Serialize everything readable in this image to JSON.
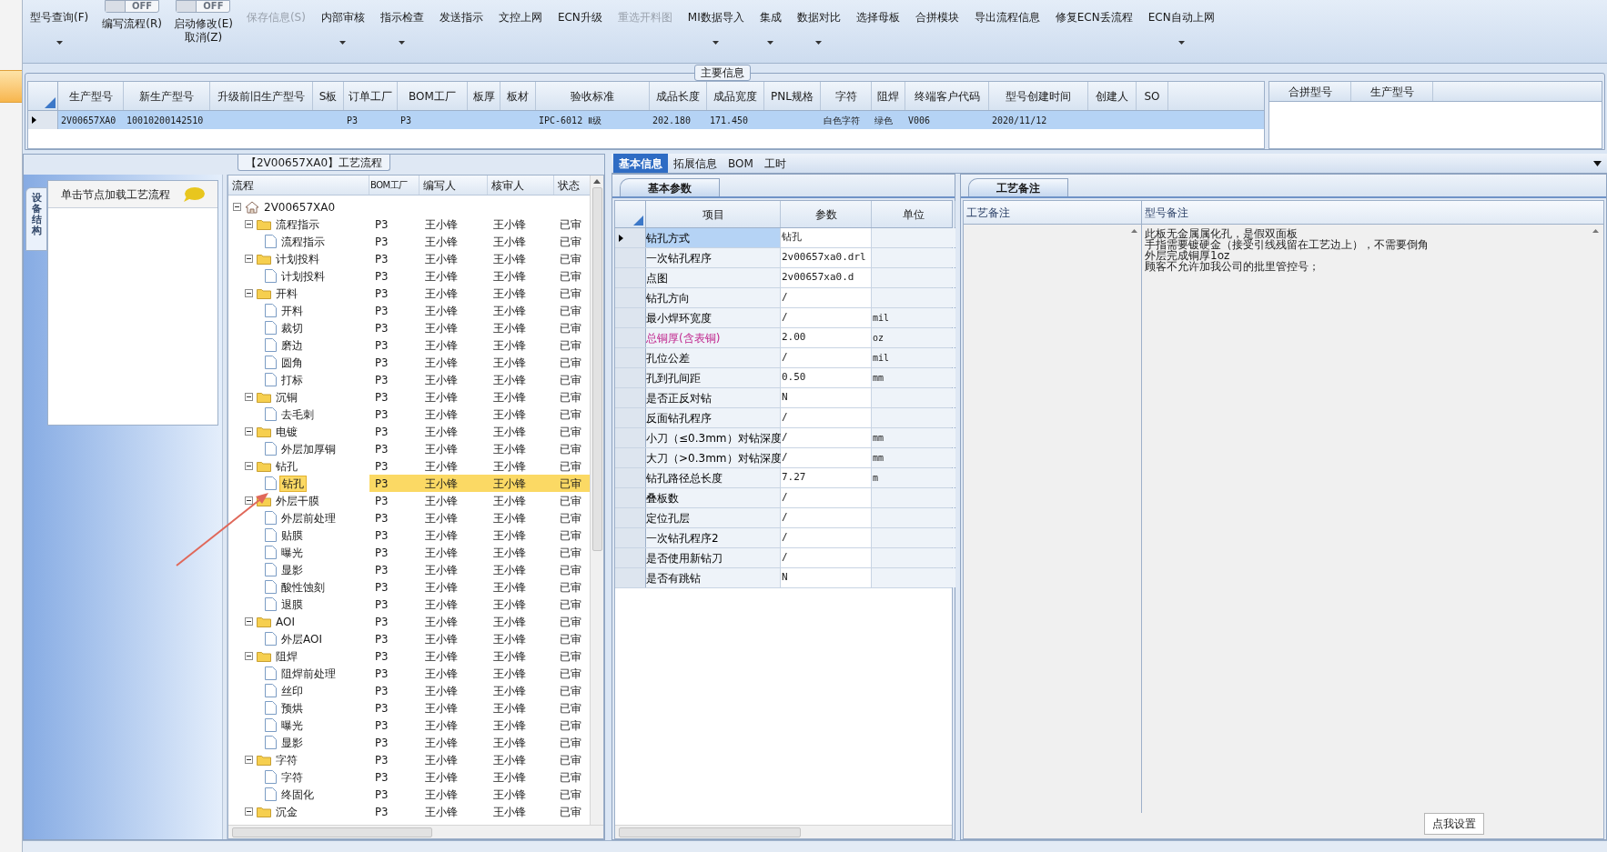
{
  "toolbar": [
    {
      "kind": "button",
      "label": "型号查询(F)",
      "dropdown": true,
      "disabled": false
    },
    {
      "kind": "toggle",
      "switch_text": "OFF",
      "on": false,
      "lines": [
        "编写流程(R)"
      ]
    },
    {
      "kind": "toggle",
      "switch_text": "OFF",
      "on": false,
      "lines": [
        "启动修改(E)",
        "取消(Z)"
      ]
    },
    {
      "kind": "button",
      "label": "保存信息(S)",
      "dropdown": false,
      "disabled": true
    },
    {
      "kind": "button",
      "label": "内部审核",
      "dropdown": true,
      "disabled": false
    },
    {
      "kind": "button",
      "label": "指示检查",
      "dropdown": true,
      "disabled": false
    },
    {
      "kind": "button",
      "label": "发送指示",
      "dropdown": false,
      "disabled": false
    },
    {
      "kind": "button",
      "label": "文控上网",
      "dropdown": false,
      "disabled": false
    },
    {
      "kind": "button",
      "label": "ECN升级",
      "dropdown": false,
      "disabled": false
    },
    {
      "kind": "button",
      "label": "重选开料图",
      "dropdown": false,
      "disabled": true
    },
    {
      "kind": "button",
      "label": "MI数据导入",
      "dropdown": true,
      "disabled": false
    },
    {
      "kind": "button",
      "label": "集成",
      "dropdown": true,
      "disabled": false
    },
    {
      "kind": "button",
      "label": "数据对比",
      "dropdown": true,
      "disabled": false
    },
    {
      "kind": "button",
      "label": "选择母板",
      "dropdown": false,
      "disabled": false
    },
    {
      "kind": "button",
      "label": "合拼模块",
      "dropdown": false,
      "disabled": false
    },
    {
      "kind": "button",
      "label": "导出流程信息",
      "dropdown": false,
      "disabled": false
    },
    {
      "kind": "button",
      "label": "修复ECN丢流程",
      "dropdown": false,
      "disabled": false
    },
    {
      "kind": "button",
      "label": "ECN自动上网",
      "dropdown": true,
      "disabled": false
    }
  ],
  "main_info": {
    "title": "主要信息",
    "columns": [
      "生产型号",
      "新生产型号",
      "升级前旧生产型号",
      "S板",
      "订单工厂",
      "BOM工厂",
      "板厚",
      "板材",
      "验收标准",
      "成品长度",
      "成品宽度",
      "PNL规格",
      "字符",
      "阻焊",
      "终端客户代码",
      "型号创建时间",
      "创建人",
      "SO"
    ],
    "rows": [
      {
        "selected": true,
        "cells": [
          "2V00657XA0",
          "10010200142510",
          null,
          null,
          "P3",
          "P3",
          null,
          null,
          "IPC-6012 Ⅱ级",
          "202.180",
          "171.450",
          null,
          "白色字符",
          "绿色",
          "V006",
          "2020/11/12",
          null,
          null
        ]
      }
    ],
    "merge_columns": [
      "合拼型号",
      "生产型号"
    ]
  },
  "flow_section": {
    "title": "【2V00657XA0】工艺流程"
  },
  "side_panel": {
    "tab": "设备结构",
    "header": "单击节点加载工艺流程"
  },
  "tree": {
    "columns": [
      "流程",
      "BOM工厂",
      "编写人",
      "核审人",
      "状态"
    ],
    "items": [
      {
        "kind": "root",
        "name": "2V00657XA0",
        "expanded": true,
        "selected": false,
        "children": [
          {
            "kind": "folder",
            "name": "流程指示",
            "bom": "P3",
            "writer": "王小锋",
            "reviewer": "王小锋",
            "status": "已审",
            "expanded": true,
            "selected": false,
            "children": [
              {
                "kind": "file",
                "name": "流程指示",
                "bom": "P3",
                "writer": "王小锋",
                "reviewer": "王小锋",
                "status": "已审",
                "selected": false
              }
            ]
          },
          {
            "kind": "folder",
            "name": "计划投料",
            "bom": "P3",
            "writer": "王小锋",
            "reviewer": "王小锋",
            "status": "已审",
            "expanded": true,
            "selected": false,
            "children": [
              {
                "kind": "file",
                "name": "计划投料",
                "bom": "P3",
                "writer": "王小锋",
                "reviewer": "王小锋",
                "status": "已审",
                "selected": false
              }
            ]
          },
          {
            "kind": "folder",
            "name": "开料",
            "bom": "P3",
            "writer": "王小锋",
            "reviewer": "王小锋",
            "status": "已审",
            "expanded": true,
            "selected": false,
            "children": [
              {
                "kind": "file",
                "name": "开料",
                "bom": "P3",
                "writer": "王小锋",
                "reviewer": "王小锋",
                "status": "已审",
                "selected": false
              },
              {
                "kind": "file",
                "name": "裁切",
                "bom": "P3",
                "writer": "王小锋",
                "reviewer": "王小锋",
                "status": "已审",
                "selected": false
              },
              {
                "kind": "file",
                "name": "磨边",
                "bom": "P3",
                "writer": "王小锋",
                "reviewer": "王小锋",
                "status": "已审",
                "selected": false
              },
              {
                "kind": "file",
                "name": "圆角",
                "bom": "P3",
                "writer": "王小锋",
                "reviewer": "王小锋",
                "status": "已审",
                "selected": false
              },
              {
                "kind": "file",
                "name": "打标",
                "bom": "P3",
                "writer": "王小锋",
                "reviewer": "王小锋",
                "status": "已审",
                "selected": false
              }
            ]
          },
          {
            "kind": "folder",
            "name": "沉铜",
            "bom": "P3",
            "writer": "王小锋",
            "reviewer": "王小锋",
            "status": "已审",
            "expanded": true,
            "selected": false,
            "children": [
              {
                "kind": "file",
                "name": "去毛刺",
                "bom": "P3",
                "writer": "王小锋",
                "reviewer": "王小锋",
                "status": "已审",
                "selected": false
              }
            ]
          },
          {
            "kind": "folder",
            "name": "电镀",
            "bom": "P3",
            "writer": "王小锋",
            "reviewer": "王小锋",
            "status": "已审",
            "expanded": true,
            "selected": false,
            "children": [
              {
                "kind": "file",
                "name": "外层加厚铜",
                "bom": "P3",
                "writer": "王小锋",
                "reviewer": "王小锋",
                "status": "已审",
                "selected": false
              }
            ]
          },
          {
            "kind": "folder",
            "name": "钻孔",
            "bom": "P3",
            "writer": "王小锋",
            "reviewer": "王小锋",
            "status": "已审",
            "expanded": true,
            "selected": false,
            "children": [
              {
                "kind": "file",
                "name": "钻孔",
                "bom": "P3",
                "writer": "王小锋",
                "reviewer": "王小锋",
                "status": "已审",
                "selected": true
              }
            ]
          },
          {
            "kind": "folder",
            "name": "外层干膜",
            "bom": "P3",
            "writer": "王小锋",
            "reviewer": "王小锋",
            "status": "已审",
            "expanded": true,
            "selected": false,
            "children": [
              {
                "kind": "file",
                "name": "外层前处理",
                "bom": "P3",
                "writer": "王小锋",
                "reviewer": "王小锋",
                "status": "已审",
                "selected": false
              },
              {
                "kind": "file",
                "name": "贴膜",
                "bom": "P3",
                "writer": "王小锋",
                "reviewer": "王小锋",
                "status": "已审",
                "selected": false
              },
              {
                "kind": "file",
                "name": "曝光",
                "bom": "P3",
                "writer": "王小锋",
                "reviewer": "王小锋",
                "status": "已审",
                "selected": false
              },
              {
                "kind": "file",
                "name": "显影",
                "bom": "P3",
                "writer": "王小锋",
                "reviewer": "王小锋",
                "status": "已审",
                "selected": false
              },
              {
                "kind": "file",
                "name": "酸性蚀刻",
                "bom": "P3",
                "writer": "王小锋",
                "reviewer": "王小锋",
                "status": "已审",
                "selected": false
              },
              {
                "kind": "file",
                "name": "退膜",
                "bom": "P3",
                "writer": "王小锋",
                "reviewer": "王小锋",
                "status": "已审",
                "selected": false
              }
            ]
          },
          {
            "kind": "folder",
            "name": "AOI",
            "bom": "P3",
            "writer": "王小锋",
            "reviewer": "王小锋",
            "status": "已审",
            "expanded": true,
            "selected": false,
            "children": [
              {
                "kind": "file",
                "name": "外层AOI",
                "bom": "P3",
                "writer": "王小锋",
                "reviewer": "王小锋",
                "status": "已审",
                "selected": false
              }
            ]
          },
          {
            "kind": "folder",
            "name": "阻焊",
            "bom": "P3",
            "writer": "王小锋",
            "reviewer": "王小锋",
            "status": "已审",
            "expanded": true,
            "selected": false,
            "children": [
              {
                "kind": "file",
                "name": "阻焊前处理",
                "bom": "P3",
                "writer": "王小锋",
                "reviewer": "王小锋",
                "status": "已审",
                "selected": false
              },
              {
                "kind": "file",
                "name": "丝印",
                "bom": "P3",
                "writer": "王小锋",
                "reviewer": "王小锋",
                "status": "已审",
                "selected": false
              },
              {
                "kind": "file",
                "name": "预烘",
                "bom": "P3",
                "writer": "王小锋",
                "reviewer": "王小锋",
                "status": "已审",
                "selected": false
              },
              {
                "kind": "file",
                "name": "曝光",
                "bom": "P3",
                "writer": "王小锋",
                "reviewer": "王小锋",
                "status": "已审",
                "selected": false
              },
              {
                "kind": "file",
                "name": "显影",
                "bom": "P3",
                "writer": "王小锋",
                "reviewer": "王小锋",
                "status": "已审",
                "selected": false
              }
            ]
          },
          {
            "kind": "folder",
            "name": "字符",
            "bom": "P3",
            "writer": "王小锋",
            "reviewer": "王小锋",
            "status": "已审",
            "expanded": true,
            "selected": false,
            "children": [
              {
                "kind": "file",
                "name": "字符",
                "bom": "P3",
                "writer": "王小锋",
                "reviewer": "王小锋",
                "status": "已审",
                "selected": false
              },
              {
                "kind": "file",
                "name": "终固化",
                "bom": "P3",
                "writer": "王小锋",
                "reviewer": "王小锋",
                "status": "已审",
                "selected": false
              }
            ]
          },
          {
            "kind": "folder",
            "name": "沉金",
            "bom": "P3",
            "writer": "王小锋",
            "reviewer": "王小锋",
            "status": "已审",
            "expanded": true,
            "selected": false
          }
        ]
      }
    ]
  },
  "detail_tabs": [
    {
      "label": "基本信息",
      "selected": true
    },
    {
      "label": "拓展信息",
      "selected": false
    },
    {
      "label": "BOM",
      "selected": false
    },
    {
      "label": "工时",
      "selected": false
    }
  ],
  "params": {
    "tab": {
      "label": "基本参数",
      "selected": true
    },
    "columns": [
      "项目",
      "参数",
      "单位"
    ],
    "rows": [
      {
        "item": "钻孔方式",
        "value": "钻孔",
        "selected": true,
        "emphasis": false
      },
      {
        "item": "一次钻孔程序",
        "value": "2v00657xa0.drl",
        "selected": false,
        "emphasis": false
      },
      {
        "item": "点图",
        "value": "2v00657xa0.d",
        "selected": false,
        "emphasis": false
      },
      {
        "item": "钻孔方向",
        "value": "/",
        "selected": false,
        "emphasis": false
      },
      {
        "item": "最小焊环宽度",
        "value": "/",
        "unit": "mil",
        "selected": false,
        "emphasis": false
      },
      {
        "item": "总铜厚(含表铜)",
        "value": "2.00",
        "unit": "oz",
        "selected": false,
        "emphasis": true
      },
      {
        "item": "孔位公差",
        "value": "/",
        "unit": "mil",
        "selected": false,
        "emphasis": false
      },
      {
        "item": "孔到孔间距",
        "value": "0.50",
        "unit": "mm",
        "selected": false,
        "emphasis": false
      },
      {
        "item": "是否正反对钻",
        "value": "N",
        "selected": false,
        "emphasis": false
      },
      {
        "item": "反面钻孔程序",
        "value": "/",
        "selected": false,
        "emphasis": false
      },
      {
        "item": "小刀（≤0.3mm）对钻深度",
        "value": "/",
        "unit": "mm",
        "selected": false,
        "emphasis": false
      },
      {
        "item": "大刀（>0.3mm）对钻深度",
        "value": "/",
        "unit": "mm",
        "selected": false,
        "emphasis": false
      },
      {
        "item": "钻孔路径总长度",
        "value": "7.27",
        "unit": "m",
        "selected": false,
        "emphasis": false
      },
      {
        "item": "叠板数",
        "value": "/",
        "selected": false,
        "emphasis": false
      },
      {
        "item": "定位孔层",
        "value": "/",
        "selected": false,
        "emphasis": false
      },
      {
        "item": "一次钻孔程序2",
        "value": "/",
        "selected": false,
        "emphasis": false
      },
      {
        "item": "是否使用新钻刀",
        "value": "/",
        "selected": false,
        "emphasis": false
      },
      {
        "item": "是否有跳钻",
        "value": "N",
        "selected": false,
        "emphasis": false
      }
    ]
  },
  "notes": {
    "tab": {
      "label": "工艺备注",
      "selected": true
    },
    "columns": [
      "工艺备注",
      "型号备注"
    ],
    "model_note_lines": [
      "此板无金属属化孔，是假双面板",
      "手指需要镀硬金（接受引线残留在工艺边上），不需要倒角",
      "外层完成铜厚1oz",
      "顾客不允许加我公司的批里管控号；"
    ],
    "settings_button": "点我设置"
  }
}
